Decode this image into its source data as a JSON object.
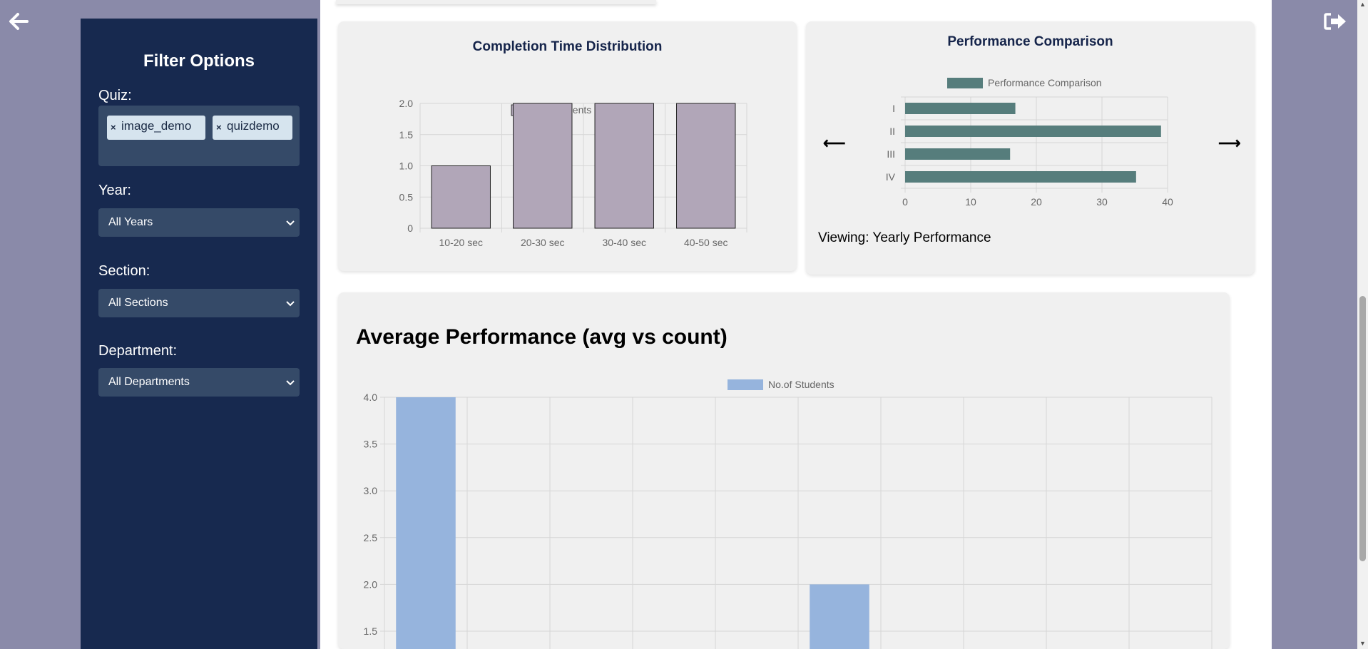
{
  "colors": {
    "sidebar": "#17294f",
    "page_bg": "#8a8aa9",
    "card_bg": "#f0f0f0",
    "bar_mauve": "#b1a6b8",
    "bar_teal": "#567d7c",
    "bar_blue": "#96b4dd"
  },
  "icons": {
    "back": "arrow-left-icon",
    "logout": "sign-out-icon"
  },
  "sidebar": {
    "title": "Filter Options",
    "quiz_label": "Quiz:",
    "quiz_tags": [
      {
        "remove": "×",
        "label": "image_demo"
      },
      {
        "remove": "×",
        "label": "quizdemo"
      }
    ],
    "year_label": "Year:",
    "year_value": "All Years",
    "section_label": "Section:",
    "section_value": "All Sections",
    "department_label": "Department:",
    "department_value": "All Departments"
  },
  "completion_card": {
    "title": "Completion Time Distribution"
  },
  "performance_card": {
    "title": "Performance Comparison",
    "prev": "⟵",
    "next": "⟶",
    "viewing": "Viewing: Yearly Performance"
  },
  "average_card": {
    "title": "Average Performance (avg vs count)"
  },
  "chart_data": [
    {
      "type": "bar",
      "title": "Completion Time Distribution",
      "categories": [
        "10-20 sec",
        "20-30 sec",
        "30-40 sec",
        "40-50 sec"
      ],
      "series": [
        {
          "name": "Students Count",
          "values": [
            1,
            2,
            2,
            2
          ]
        }
      ],
      "ylim": [
        0,
        2
      ],
      "yticks": [
        "0",
        "0.5",
        "1.0",
        "1.5",
        "2.0"
      ],
      "legend": "top",
      "grid": true
    },
    {
      "type": "bar",
      "orientation": "horizontal",
      "title": "Performance Comparison",
      "categories": [
        "I",
        "II",
        "III",
        "IV"
      ],
      "series": [
        {
          "name": "Performance Comparison",
          "values": [
            16.8,
            39,
            16,
            35.2
          ]
        }
      ],
      "xlim": [
        0,
        40
      ],
      "xticks": [
        "0",
        "10",
        "20",
        "30",
        "40"
      ],
      "legend": "top",
      "grid": true
    },
    {
      "type": "bar",
      "title": "Average Performance (avg vs count)",
      "series": [
        {
          "name": "No.of Students",
          "values": [
            4,
            null,
            null,
            null,
            null,
            2,
            null,
            null,
            null,
            null
          ]
        }
      ],
      "ylim": [
        1.5,
        4.0
      ],
      "yticks": [
        "4.0",
        "3.5",
        "3.0",
        "2.5",
        "2.0",
        "1.5"
      ],
      "legend": "top",
      "grid": true
    }
  ]
}
